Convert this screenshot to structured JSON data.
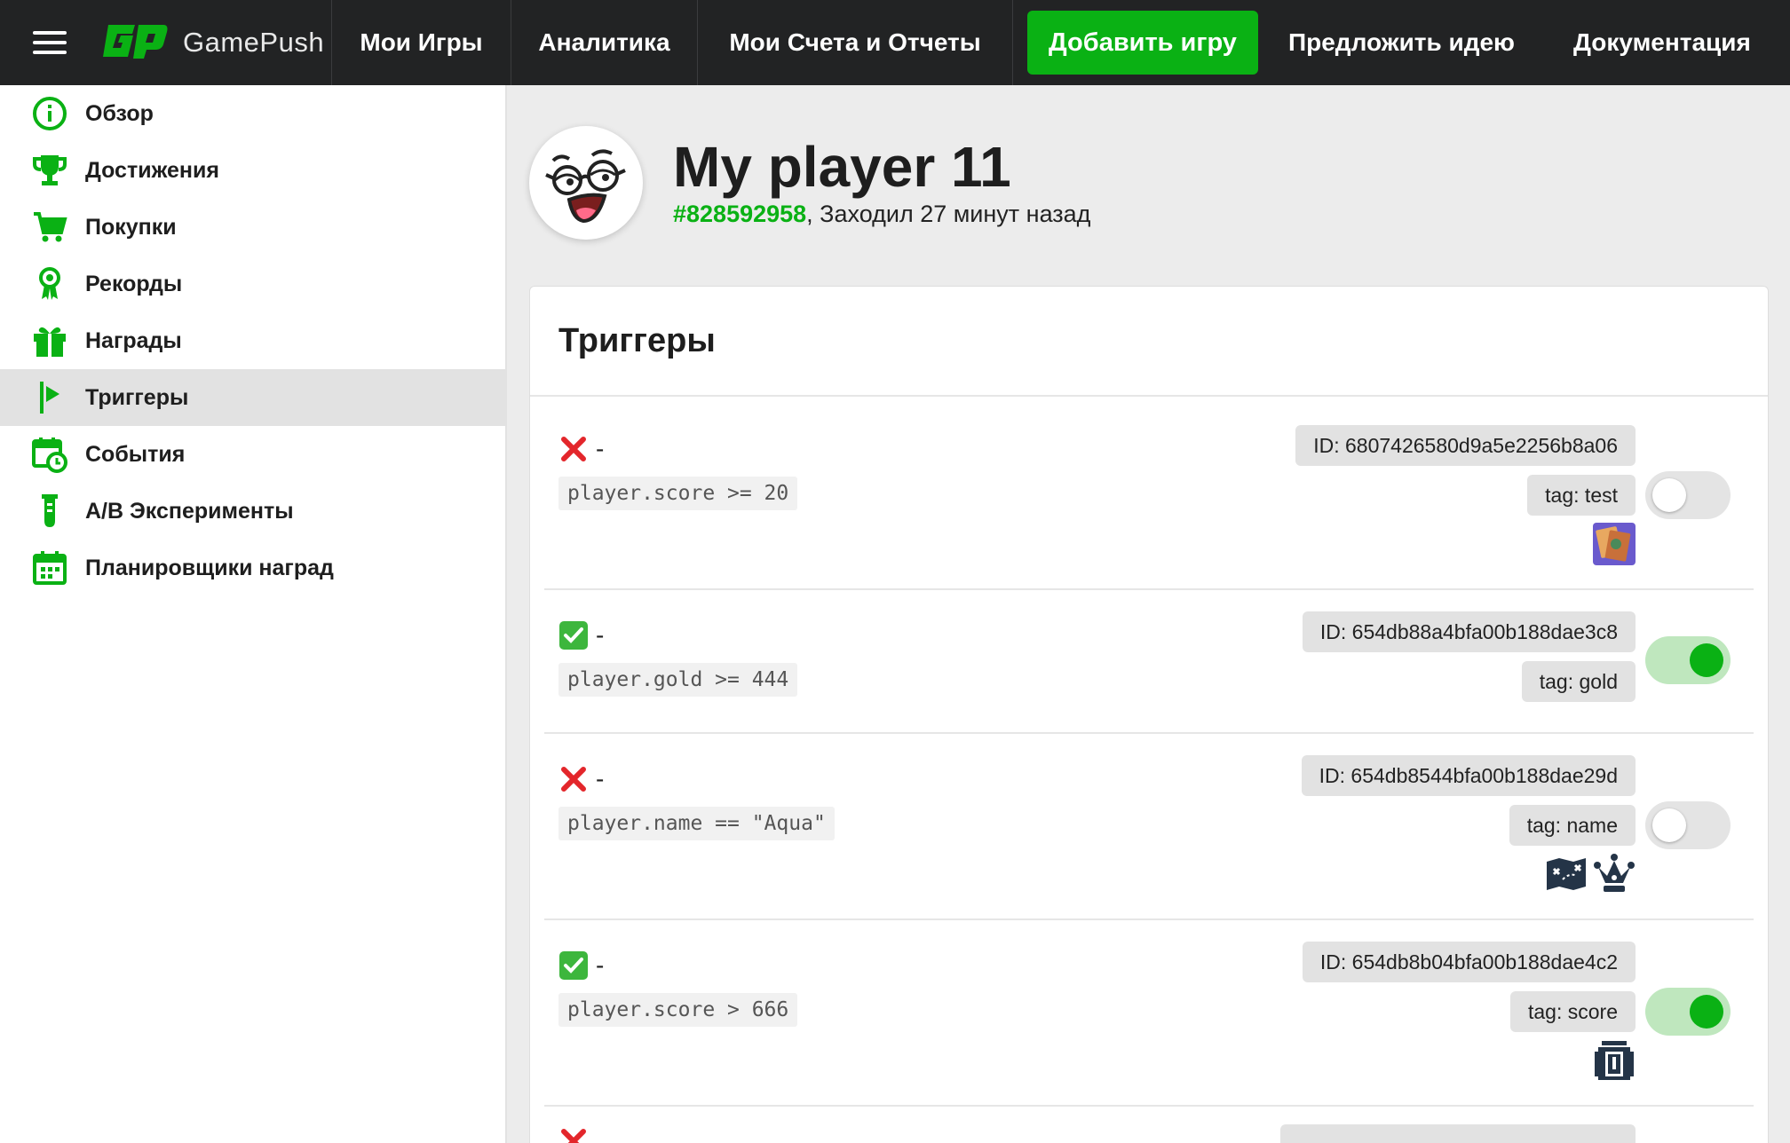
{
  "app": {
    "logo_text": "GamePush"
  },
  "topnav": {
    "games": "Мои Игры",
    "analytics": "Аналитика",
    "billing": "Мои Счета и Отчеты",
    "add_game": "Добавить игру",
    "suggest_idea": "Предложить идею",
    "docs": "Документация"
  },
  "sidebar": {
    "items": [
      {
        "label": "Обзор",
        "icon": "info-icon"
      },
      {
        "label": "Достижения",
        "icon": "trophy-icon"
      },
      {
        "label": "Покупки",
        "icon": "cart-icon"
      },
      {
        "label": "Рекорды",
        "icon": "medal-icon"
      },
      {
        "label": "Награды",
        "icon": "gift-icon"
      },
      {
        "label": "Триггеры",
        "icon": "flag-icon",
        "active": true
      },
      {
        "label": "События",
        "icon": "calendar-clock-icon"
      },
      {
        "label": "A/B Эксперименты",
        "icon": "test-tube-icon"
      },
      {
        "label": "Планировщики наград",
        "icon": "calendar-icon"
      }
    ]
  },
  "player": {
    "name": "My player 11",
    "id": "#828592958",
    "last_seen": ", Заходил 27 минут назад"
  },
  "triggers": {
    "title": "Триггеры",
    "items": [
      {
        "done": false,
        "dash": "-",
        "condition": "player.score >= 20",
        "id": "ID: 6807426580d9a5e2256b8a06",
        "tag": "tag: test",
        "enabled": false,
        "rewards": [
          "card-reward-icon"
        ]
      },
      {
        "done": true,
        "dash": "-",
        "condition": "player.gold >= 444",
        "id": "ID: 654db88a4bfa00b188dae3c8",
        "tag": "tag: gold",
        "enabled": true,
        "rewards": []
      },
      {
        "done": false,
        "dash": "-",
        "condition": "player.name == \"Aqua\"",
        "id": "ID: 654db8544bfa00b188dae29d",
        "tag": "tag: name",
        "enabled": false,
        "rewards": [
          "map-reward-icon",
          "crown-reward-icon"
        ]
      },
      {
        "done": true,
        "dash": "-",
        "condition": "player.score > 666",
        "id": "ID: 654db8b04bfa00b188dae4c2",
        "tag": "tag: score",
        "enabled": true,
        "rewards": [
          "door-reward-icon"
        ]
      }
    ]
  },
  "colors": {
    "accent": "#0ab114",
    "topbar": "#222324",
    "error": "#e3262b"
  }
}
